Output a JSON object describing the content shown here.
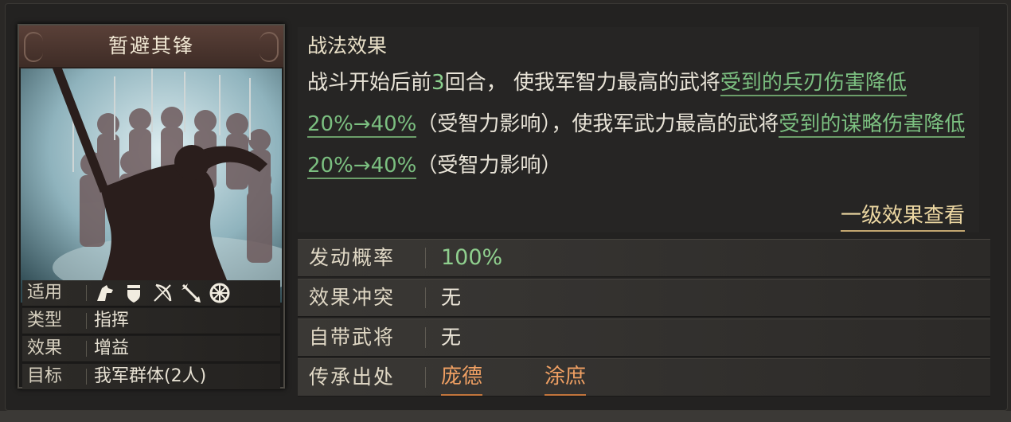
{
  "skill_card": {
    "title": "暂避其锋",
    "props": [
      {
        "label": "适用",
        "value": ""
      },
      {
        "label": "类型",
        "value": "指挥"
      },
      {
        "label": "效果",
        "value": "增益"
      },
      {
        "label": "目标",
        "value": "我军群体(2人)"
      }
    ],
    "troop_icons": [
      "cavalry-icon",
      "shield-icon",
      "bow-icon",
      "spear-icon",
      "siege-wheel-icon"
    ]
  },
  "effect": {
    "title": "战法效果",
    "seg1": "战斗开始后前",
    "rounds": "3",
    "seg2": "回合， 使我军智力最高的武将",
    "hl1": "受到的兵刃伤害降低",
    "val1": "20%→40%",
    "seg3": "（受智力影响），使我军武力最高的武将",
    "hl2": "受到的谋略伤害降低",
    "val2": "20%→40%",
    "seg4": "（受智力影响）",
    "more_link": "一级效果查看"
  },
  "info": {
    "trigger_label": "发动概率",
    "trigger_value": "100%",
    "conflict_label": "效果冲突",
    "conflict_value": "无",
    "own_general_label": "自带武将",
    "own_general_value": "无",
    "inherit_label": "传承出处",
    "inherit_generals": [
      "庞德",
      "涂庶"
    ]
  },
  "colors": {
    "highlight_green": "#7bbf80",
    "heir_orange": "#f0a063",
    "link_gold": "#ecd7a2"
  }
}
